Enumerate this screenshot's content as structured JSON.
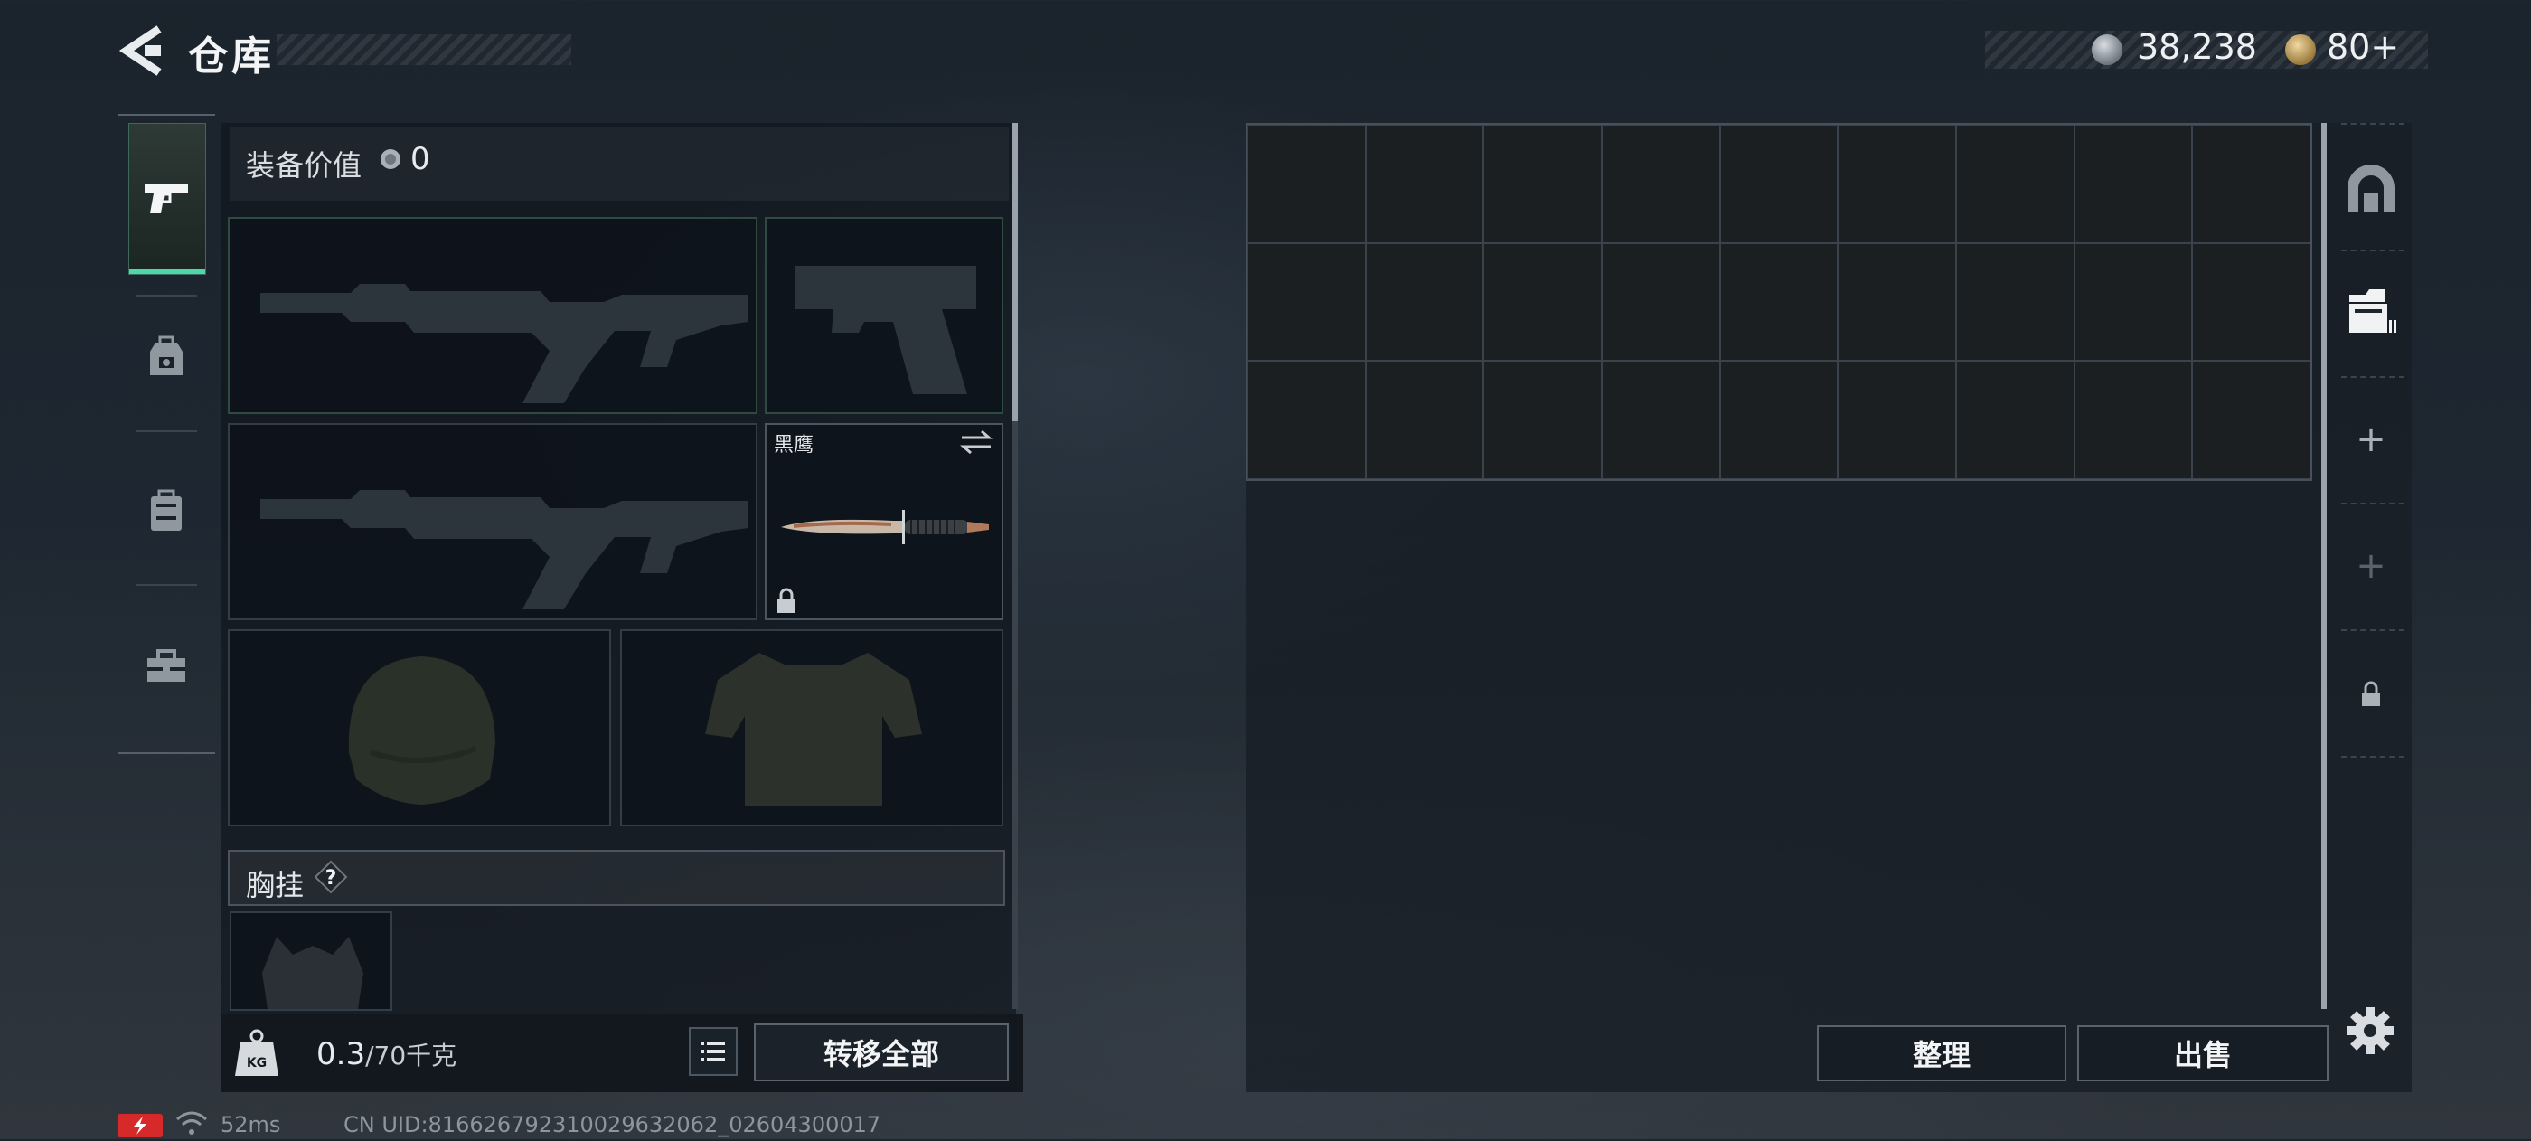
{
  "header": {
    "title": "仓库",
    "currency_silver": "38,238",
    "currency_gold": "80+"
  },
  "categories": [
    {
      "name": "firearms",
      "icon": "pistol-icon",
      "active": true
    },
    {
      "name": "armor",
      "icon": "backpack-armor-icon",
      "active": false
    },
    {
      "name": "container",
      "icon": "case-icon",
      "active": false
    },
    {
      "name": "tools",
      "icon": "toolbox-icon",
      "active": false
    }
  ],
  "equipment": {
    "value_label": "装备价值",
    "value": "0",
    "slots": [
      {
        "type": "primary-weapon-1",
        "icon": "assault-rifle-icon",
        "name": ""
      },
      {
        "type": "sidearm",
        "icon": "pistol-icon",
        "name": ""
      },
      {
        "type": "primary-weapon-2",
        "icon": "assault-rifle-icon",
        "name": ""
      },
      {
        "type": "melee",
        "icon": "knife-icon",
        "name": "黑鹰",
        "locked": true
      },
      {
        "type": "helmet",
        "icon": "helmet-icon",
        "name": ""
      },
      {
        "type": "body-armor",
        "icon": "vest-icon",
        "name": ""
      }
    ],
    "chest_rig": {
      "label": "胸挂",
      "help": "?"
    }
  },
  "footer_left": {
    "weight_current": "0.3",
    "weight_rest": "/70千克",
    "transfer_all": "转移全部"
  },
  "storage": {
    "grid": {
      "cols": 9,
      "rows": 3
    },
    "tabs": [
      {
        "icon": "shelter-icon"
      },
      {
        "icon": "storage-box-icon"
      },
      {
        "icon": "plus-icon",
        "label": "+"
      },
      {
        "icon": "plus-icon",
        "label": "+"
      },
      {
        "icon": "lock-icon"
      }
    ],
    "sort_label": "整理",
    "sell_label": "出售"
  },
  "status": {
    "ping": "52ms",
    "uid": "CN UID:816626792310029632062_02604300017"
  },
  "colors": {
    "accent": "#4ed6ad",
    "battery": "#d62a2a"
  }
}
